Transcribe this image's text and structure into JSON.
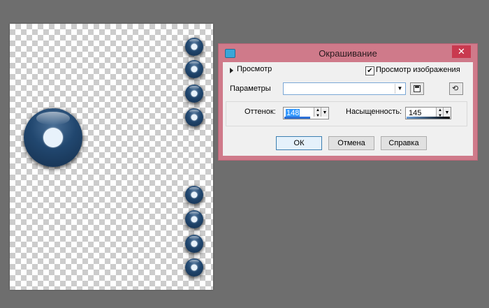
{
  "dialog": {
    "title": "Окрашивание",
    "close_glyph": "✕",
    "preview_label": "Просмотр",
    "image_preview_label": "Просмотр изображения",
    "image_preview_checked": true,
    "check_glyph": "✔",
    "presets_label": "Параметры",
    "presets_value": "",
    "hue_label": "Оттенок:",
    "hue_value": "148",
    "saturation_label": "Насыщенность:",
    "saturation_value": "145",
    "ok_label": "ОК",
    "cancel_label": "Отмена",
    "help_label": "Справка"
  },
  "icons": {
    "app": "hue-app-icon",
    "save": "save-preset-icon",
    "reset": "reset-defaults-icon"
  },
  "colors": {
    "desktop": "#6e6e6e",
    "titlebar": "#cf7a8a",
    "ball": "#21476f",
    "selection": "#3399ff"
  }
}
